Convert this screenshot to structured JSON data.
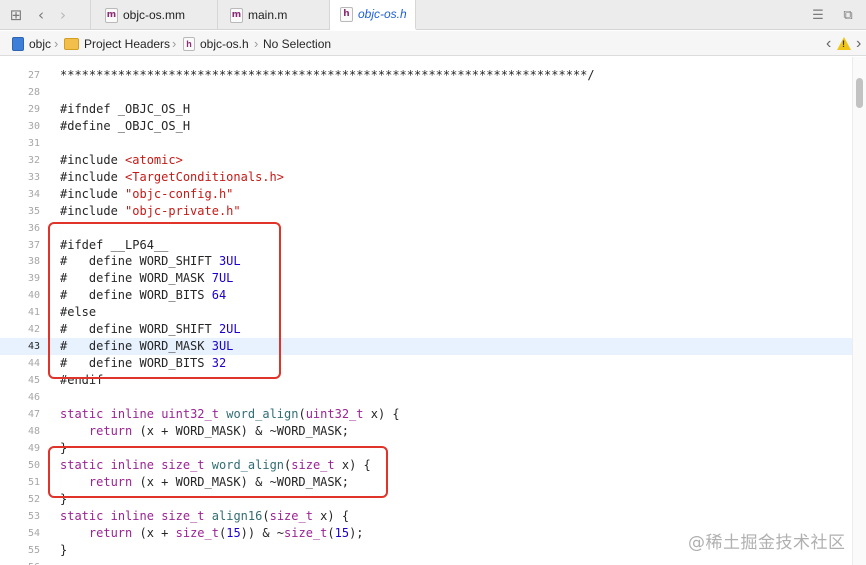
{
  "tabs": [
    {
      "label": "objc-os.mm",
      "icon": "m",
      "active": false
    },
    {
      "label": "main.m",
      "icon": "m",
      "active": false
    },
    {
      "label": "objc-os.h",
      "icon": "h",
      "active": true
    }
  ],
  "jumpbar": {
    "project": "objc",
    "group": "Project Headers",
    "file": "objc-os.h",
    "selection": "No Selection"
  },
  "editor": {
    "current_line": 43,
    "lines": [
      {
        "n": "27",
        "text": "*************************************************************************/"
      },
      {
        "n": "28",
        "text": ""
      },
      {
        "n": "29",
        "text": "#ifndef _OBJC_OS_H"
      },
      {
        "n": "30",
        "text": "#define _OBJC_OS_H"
      },
      {
        "n": "31",
        "text": ""
      },
      {
        "n": "32",
        "text": "#include <atomic>"
      },
      {
        "n": "33",
        "text": "#include <TargetConditionals.h>"
      },
      {
        "n": "34",
        "text": "#include \"objc-config.h\""
      },
      {
        "n": "35",
        "text": "#include \"objc-private.h\""
      },
      {
        "n": "36",
        "text": ""
      },
      {
        "n": "37",
        "text": "#ifdef __LP64__"
      },
      {
        "n": "38",
        "text": "#   define WORD_SHIFT 3UL"
      },
      {
        "n": "39",
        "text": "#   define WORD_MASK 7UL"
      },
      {
        "n": "40",
        "text": "#   define WORD_BITS 64"
      },
      {
        "n": "41",
        "text": "#else"
      },
      {
        "n": "42",
        "text": "#   define WORD_SHIFT 2UL"
      },
      {
        "n": "43",
        "text": "#   define WORD_MASK 3UL"
      },
      {
        "n": "44",
        "text": "#   define WORD_BITS 32"
      },
      {
        "n": "45",
        "text": "#endif"
      },
      {
        "n": "46",
        "text": ""
      },
      {
        "n": "47",
        "text": "static inline uint32_t word_align(uint32_t x) {"
      },
      {
        "n": "48",
        "text": "    return (x + WORD_MASK) & ~WORD_MASK;"
      },
      {
        "n": "49",
        "text": "}"
      },
      {
        "n": "50",
        "text": "static inline size_t word_align(size_t x) {"
      },
      {
        "n": "51",
        "text": "    return (x + WORD_MASK) & ~WORD_MASK;"
      },
      {
        "n": "52",
        "text": "}"
      },
      {
        "n": "53",
        "text": "static inline size_t align16(size_t x) {"
      },
      {
        "n": "54",
        "text": "    return (x + size_t(15)) & ~size_t(15);"
      },
      {
        "n": "55",
        "text": "}"
      },
      {
        "n": "56",
        "text": ""
      }
    ]
  },
  "watermark": "@稀土掘金技术社区",
  "colors": {
    "keyword": "#9b2393",
    "string": "#c41a16",
    "number": "#1c00cf",
    "function": "#326d74",
    "highlight_box": "#e0342a"
  }
}
